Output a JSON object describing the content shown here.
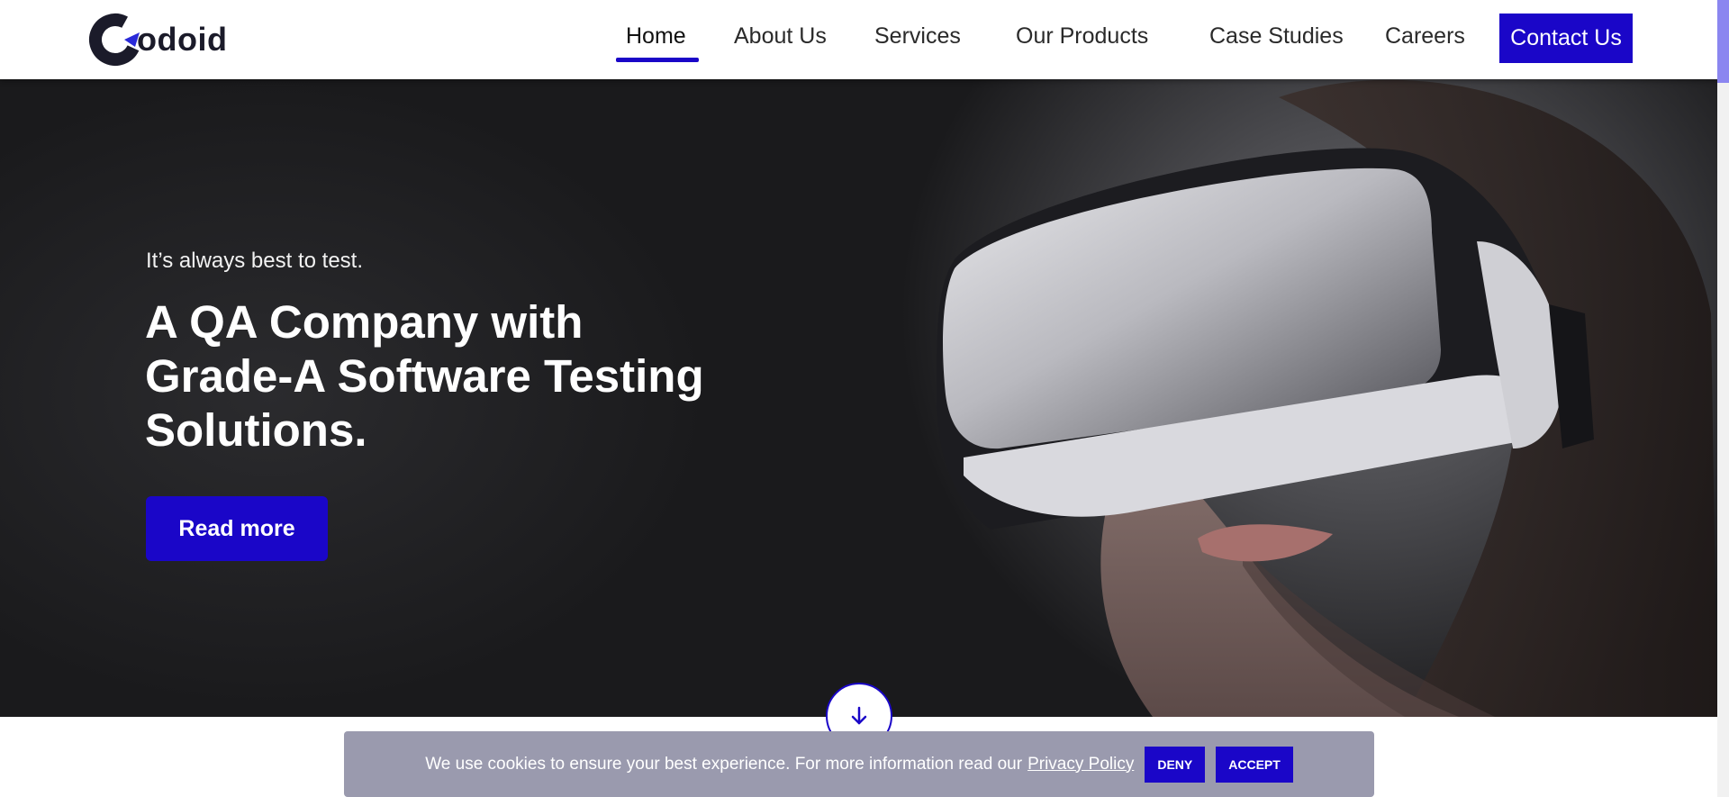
{
  "brand": {
    "logo_text": "odoid",
    "accent_color": "#1a06c8"
  },
  "nav": {
    "items": [
      {
        "label": "Home",
        "active": true
      },
      {
        "label": "About Us"
      },
      {
        "label": "Services"
      },
      {
        "label": "Our Products"
      },
      {
        "label": "Case Studies"
      },
      {
        "label": "Careers"
      }
    ],
    "contact_label": "Contact Us"
  },
  "hero": {
    "tagline": "It’s always best to test.",
    "headline": "A QA Company with Grade-A Software Testing Solutions.",
    "cta_label": "Read more",
    "scroll_icon": "arrow-down-icon"
  },
  "cookie": {
    "message": "We use cookies to ensure your best experience. For more information read our",
    "link_label": "Privacy Policy",
    "deny_label": "DENY",
    "accept_label": "ACCEPT"
  }
}
